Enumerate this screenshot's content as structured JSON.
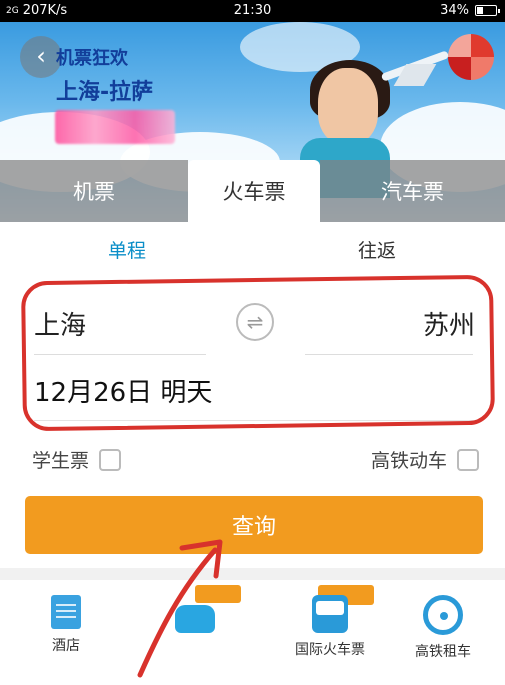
{
  "status_bar": {
    "signal": "2G",
    "speed": "207K/s",
    "time": "21:30",
    "battery": "34%"
  },
  "banner": {
    "promo_line1": "机票狂欢",
    "promo_line2": "上海-拉萨"
  },
  "tabs": [
    {
      "label": "机票",
      "active": false
    },
    {
      "label": "火车票",
      "active": true
    },
    {
      "label": "汽车票",
      "active": false
    }
  ],
  "trip_mode": [
    {
      "label": "单程",
      "active": true
    },
    {
      "label": "往返",
      "active": false
    }
  ],
  "route": {
    "from": "上海",
    "to": "苏州",
    "swap_symbol": "⇌",
    "date": "12月26日 明天"
  },
  "options": {
    "student_ticket": "学生票",
    "high_speed": "高铁动车"
  },
  "search_button": "查询",
  "bottom_nav": [
    {
      "label": "酒店",
      "icon": "hotel-icon"
    },
    {
      "label": "",
      "icon": "car-icon"
    },
    {
      "label": "国际火车票",
      "icon": "train-icon"
    },
    {
      "label": "高铁租车",
      "icon": "steering-wheel-icon"
    }
  ],
  "colors": {
    "accent": "#f29b1f",
    "active_tab_text": "#0a8ec8",
    "annotation": "#d8322c"
  }
}
